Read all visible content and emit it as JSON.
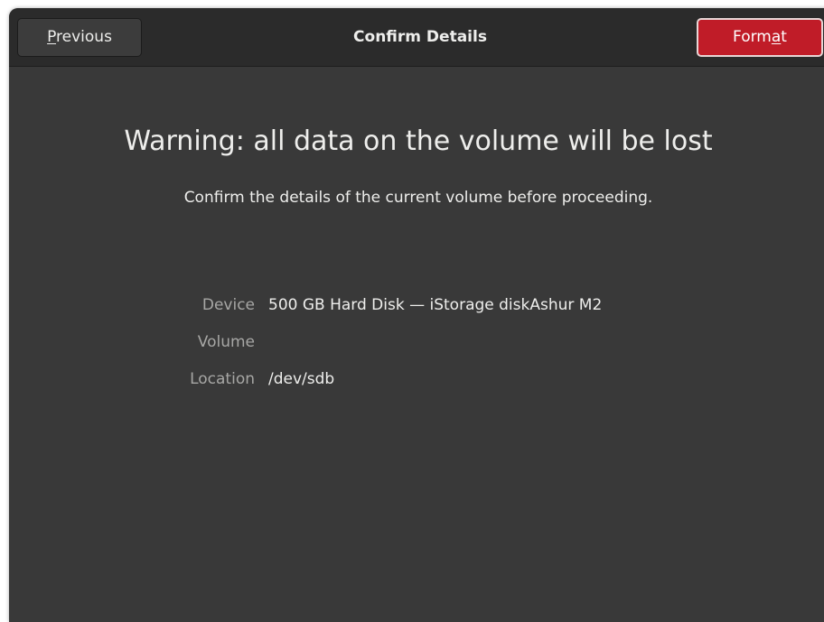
{
  "header": {
    "previous_label_underlined": "P",
    "previous_label_rest": "revious",
    "title": "Confirm Details",
    "format_label_pre": "Form",
    "format_label_underlined": "a",
    "format_label_post": "t"
  },
  "content": {
    "warning_title": "Warning: all data on the volume will be lost",
    "warning_subtitle": "Confirm the details of the current volume before proceeding.",
    "details": [
      {
        "key": "Device",
        "value": "500 GB Hard Disk — iStorage diskAshur M2"
      },
      {
        "key": "Volume",
        "value": ""
      },
      {
        "key": "Location",
        "value": "/dev/sdb"
      }
    ]
  },
  "colors": {
    "window_bg": "#393939",
    "headerbar_bg": "#2b2b2b",
    "destructive_accent": "#c01c28",
    "dim_label": "#a7a7a5",
    "text": "#eeeeec"
  }
}
